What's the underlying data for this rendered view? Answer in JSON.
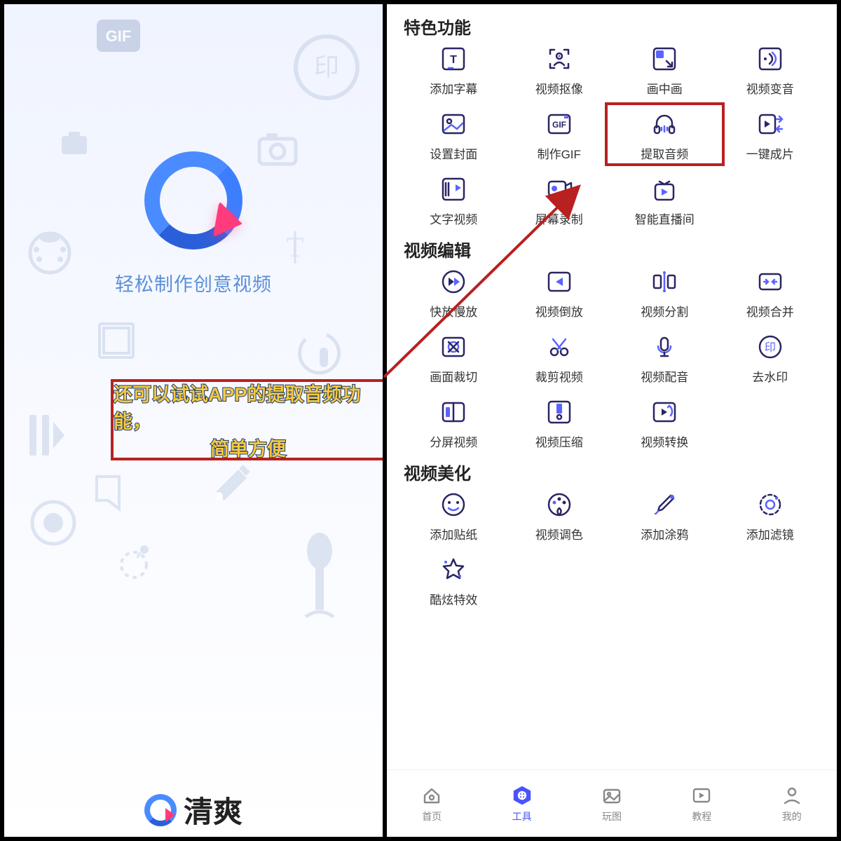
{
  "left": {
    "slogan": "轻松制作创意视频",
    "brand": "清爽",
    "annotation_line1": "还可以试试APP的提取音频功能，",
    "annotation_line2": "简单方便"
  },
  "right": {
    "sections": [
      {
        "title": "特色功能",
        "tools": [
          {
            "label": "添加字幕",
            "icon": "text"
          },
          {
            "label": "视频抠像",
            "icon": "person"
          },
          {
            "label": "画中画",
            "icon": "pip"
          },
          {
            "label": "视频变音",
            "icon": "voice"
          },
          {
            "label": "设置封面",
            "icon": "image"
          },
          {
            "label": "制作GIF",
            "icon": "gif"
          },
          {
            "label": "提取音频",
            "icon": "headphone",
            "highlight": true
          },
          {
            "label": "一键成片",
            "icon": "quickvideo"
          },
          {
            "label": "文字视频",
            "icon": "textvideo"
          },
          {
            "label": "屏幕录制",
            "icon": "record"
          },
          {
            "label": "智能直播间",
            "icon": "live"
          }
        ]
      },
      {
        "title": "视频编辑",
        "tools": [
          {
            "label": "快放慢放",
            "icon": "speed"
          },
          {
            "label": "视频倒放",
            "icon": "reverse"
          },
          {
            "label": "视频分割",
            "icon": "split"
          },
          {
            "label": "视频合并",
            "icon": "merge"
          },
          {
            "label": "画面裁切",
            "icon": "crop"
          },
          {
            "label": "裁剪视频",
            "icon": "cut"
          },
          {
            "label": "视频配音",
            "icon": "mic"
          },
          {
            "label": "去水印",
            "icon": "watermark"
          },
          {
            "label": "分屏视频",
            "icon": "splitscreen"
          },
          {
            "label": "视频压缩",
            "icon": "compress"
          },
          {
            "label": "视频转换",
            "icon": "convert"
          }
        ]
      },
      {
        "title": "视频美化",
        "tools": [
          {
            "label": "添加贴纸",
            "icon": "sticker"
          },
          {
            "label": "视频调色",
            "icon": "color"
          },
          {
            "label": "添加涂鸦",
            "icon": "brush"
          },
          {
            "label": "添加滤镜",
            "icon": "filter"
          },
          {
            "label": "酷炫特效",
            "icon": "effects"
          }
        ]
      }
    ]
  },
  "tabbar": [
    {
      "label": "首页",
      "icon": "home"
    },
    {
      "label": "工具",
      "icon": "tools",
      "active": true
    },
    {
      "label": "玩图",
      "icon": "pictures"
    },
    {
      "label": "教程",
      "icon": "tutorial"
    },
    {
      "label": "我的",
      "icon": "profile"
    }
  ]
}
